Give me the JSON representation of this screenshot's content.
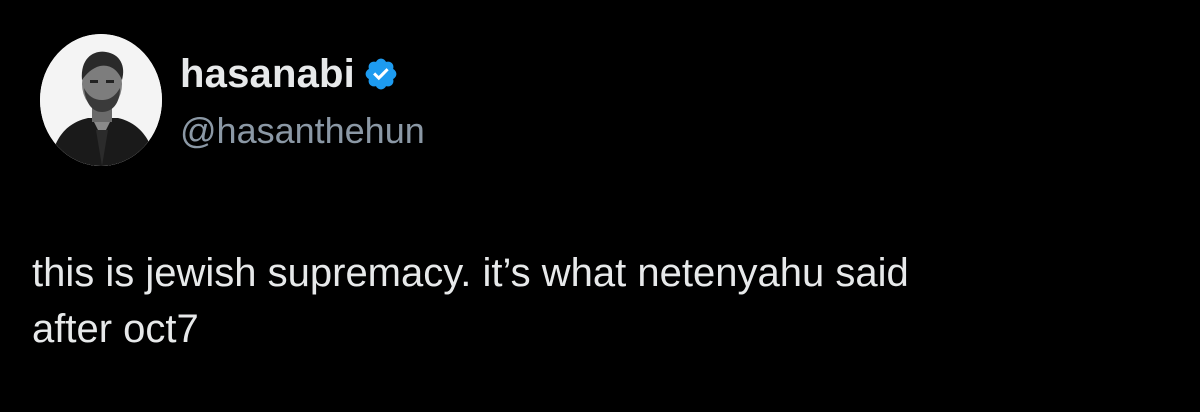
{
  "tweet": {
    "author": {
      "display_name": "hasanabi",
      "handle": "@hasanthehun",
      "verified": true
    },
    "text": "this is jewish supremacy. it’s what netenyahu said\nafter oct7"
  },
  "colors": {
    "background": "#000000",
    "primary_text": "#e7e9ea",
    "secondary_text": "#8b98a5",
    "verified_badge": "#1d9bf0"
  },
  "icons": {
    "verified": "verified-badge-icon",
    "avatar": "profile-avatar"
  }
}
